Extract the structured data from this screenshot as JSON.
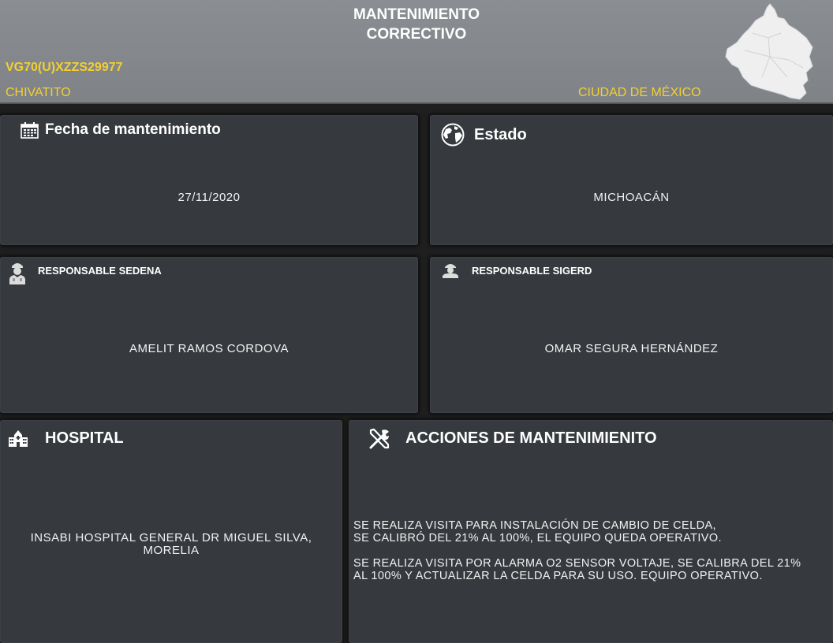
{
  "header": {
    "title_line1": "MANTENIMIENTO",
    "title_line2": "CORRECTIVO",
    "serial": "VG70(U)XZZS29977",
    "location": "CHIVATITO",
    "city": "CIUDAD DE MÉXICO",
    "map_icon": "cdmx-map-icon"
  },
  "fecha": {
    "label": "Fecha de mantenimiento",
    "value": "27/11/2020",
    "icon": "calendar-icon"
  },
  "estado": {
    "label": "Estado",
    "value": "MICHOACÁN",
    "icon": "globe-icon"
  },
  "sedena": {
    "label": "RESPONSABLE SEDENA",
    "value": "AMELIT RAMOS CORDOVA",
    "icon": "soldier-icon"
  },
  "sigerd": {
    "label": "RESPONSABLE SIGERD",
    "value": "OMAR SEGURA HERNÁNDEZ",
    "icon": "person-icon"
  },
  "hospital": {
    "label": "HOSPITAL",
    "value_line1": "INSABI HOSPITAL GENERAL DR MIGUEL SILVA,",
    "value_line2": "MORELIA",
    "icon": "hospital-icon"
  },
  "acciones": {
    "label": "ACCIONES DE MANTENIMIENITO",
    "icon": "tools-icon",
    "paragraphs": [
      {
        "line1": "SE REALIZA VISITA PARA INSTALACIÓN DE CAMBIO DE CELDA,",
        "line2": "SE CALIBRÓ DEL 21% AL 100%, EL EQUIPO QUEDA OPERATIVO."
      },
      {
        "line1": "SE REALIZA VISITA POR ALARMA O2 SENSOR VOLTAJE, SE CALIBRA DEL 21%",
        "line2": "AL 100% Y ACTUALIZAR LA CELDA PARA SU USO. EQUIPO OPERATIVO."
      }
    ]
  },
  "colors": {
    "header_bg": "#878b8f",
    "card_bg": "#363a3e",
    "accent_yellow": "#f3d02f",
    "text": "#ffffff"
  }
}
